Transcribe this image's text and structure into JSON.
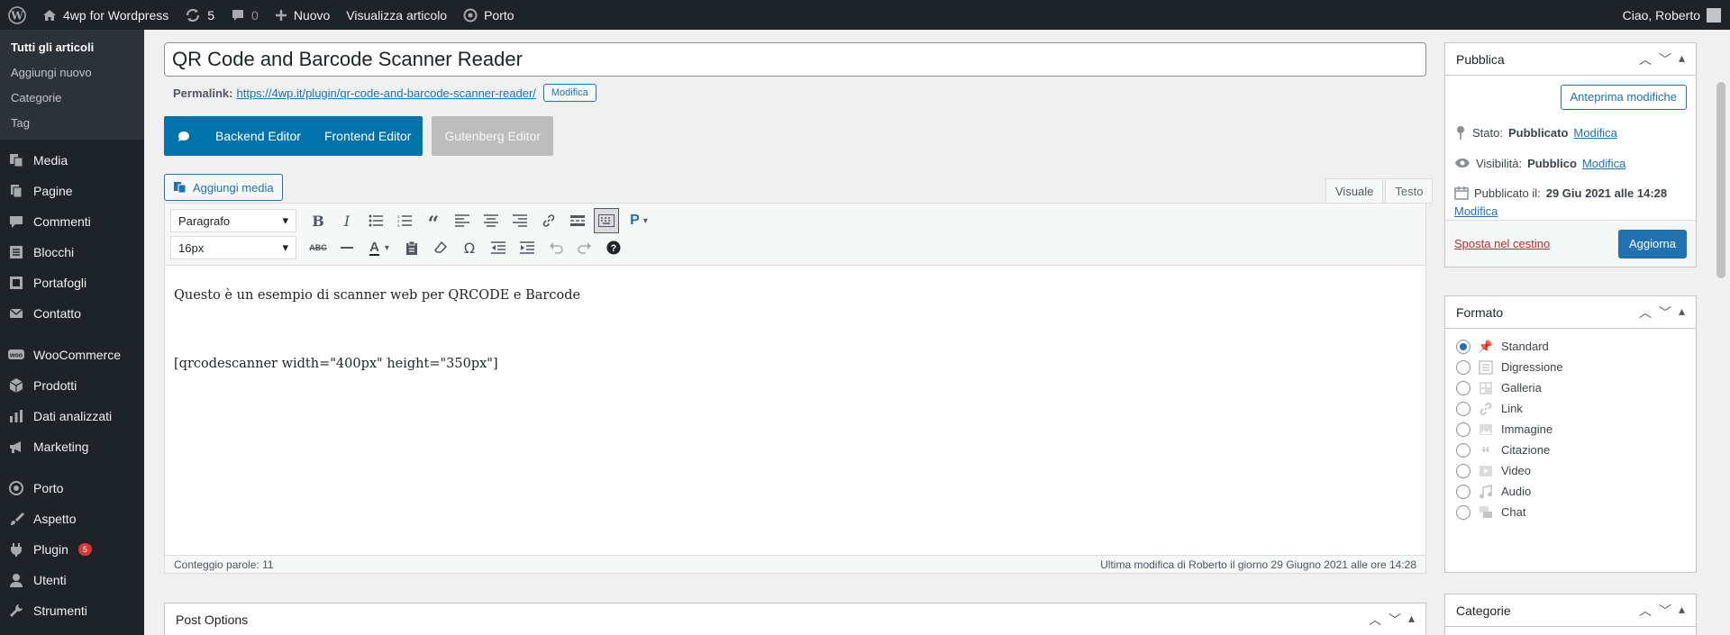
{
  "adminbar": {
    "site_name": "4wp for Wordpress",
    "updates_count": "5",
    "comments_count": "0",
    "new_label": "Nuovo",
    "view_label": "Visualizza articolo",
    "theme_label": "Porto",
    "greeting": "Ciao, Roberto"
  },
  "sidebar": {
    "submenu": [
      "Tutti gli articoli",
      "Aggiungi nuovo",
      "Categorie",
      "Tag"
    ],
    "items": [
      {
        "label": "Media",
        "icon": "media-icon"
      },
      {
        "label": "Pagine",
        "icon": "pages-icon"
      },
      {
        "label": "Commenti",
        "icon": "comments-icon"
      },
      {
        "label": "Blocchi",
        "icon": "blocks-icon"
      },
      {
        "label": "Portafogli",
        "icon": "portfolio-icon"
      },
      {
        "label": "Contatto",
        "icon": "mail-icon"
      },
      {
        "label": "WooCommerce",
        "icon": "woocommerce-icon"
      },
      {
        "label": "Prodotti",
        "icon": "box-icon"
      },
      {
        "label": "Dati analizzati",
        "icon": "chart-icon"
      },
      {
        "label": "Marketing",
        "icon": "megaphone-icon"
      },
      {
        "label": "Porto",
        "icon": "porto-icon"
      },
      {
        "label": "Aspetto",
        "icon": "brush-icon"
      },
      {
        "label": "Plugin",
        "icon": "plugin-icon",
        "badge": "5"
      },
      {
        "label": "Utenti",
        "icon": "users-icon"
      },
      {
        "label": "Strumenti",
        "icon": "tools-icon"
      }
    ]
  },
  "post": {
    "title": "QR Code and Barcode Scanner Reader",
    "permalink_label": "Permalink:",
    "permalink_url": "https://4wp.it/plugin/qr-code-and-barcode-scanner-reader/",
    "permalink_edit": "Modifica"
  },
  "builder": {
    "backend": "Backend Editor",
    "frontend": "Frontend Editor",
    "gutenberg": "Gutenberg Editor"
  },
  "editor": {
    "add_media": "Aggiungi media",
    "tab_visual": "Visuale",
    "tab_text": "Testo",
    "format_select": "Paragrafo",
    "size_select": "16px",
    "line1": "Questo è un esempio di scanner web per QRCODE e Barcode",
    "line2": "[qrcodescanner width=\"400px\" height=\"350px\"]",
    "word_count": "Conteggio parole: 11",
    "last_modified": "Ultima modifica di Roberto il giorno 29 Giugno 2021 alle ore 14:28"
  },
  "post_options": {
    "title": "Post Options"
  },
  "publish": {
    "title": "Pubblica",
    "preview": "Anteprima modifiche",
    "status_label": "Stato:",
    "status_value": "Pubblicato",
    "visibility_label": "Visibilità:",
    "visibility_value": "Pubblico",
    "published_label": "Pubblicato il:",
    "published_value": "29 Giu 2021 alle 14:28",
    "edit": "Modifica",
    "trash": "Sposta nel cestino",
    "update": "Aggiorna"
  },
  "format": {
    "title": "Formato",
    "selected": "Standard",
    "options": [
      {
        "label": "Standard",
        "icon": "pin-icon"
      },
      {
        "label": "Digressione",
        "icon": "aside-icon"
      },
      {
        "label": "Galleria",
        "icon": "gallery-icon"
      },
      {
        "label": "Link",
        "icon": "link-icon"
      },
      {
        "label": "Immagine",
        "icon": "image-icon"
      },
      {
        "label": "Citazione",
        "icon": "quote-icon"
      },
      {
        "label": "Video",
        "icon": "video-icon"
      },
      {
        "label": "Audio",
        "icon": "audio-icon"
      },
      {
        "label": "Chat",
        "icon": "chat-icon"
      }
    ]
  },
  "categories": {
    "title": "Categorie"
  },
  "colors": {
    "admin_dark": "#1d2327",
    "accent": "#2271b1",
    "builder_blue": "#0073aa",
    "badge_red": "#d63638"
  }
}
